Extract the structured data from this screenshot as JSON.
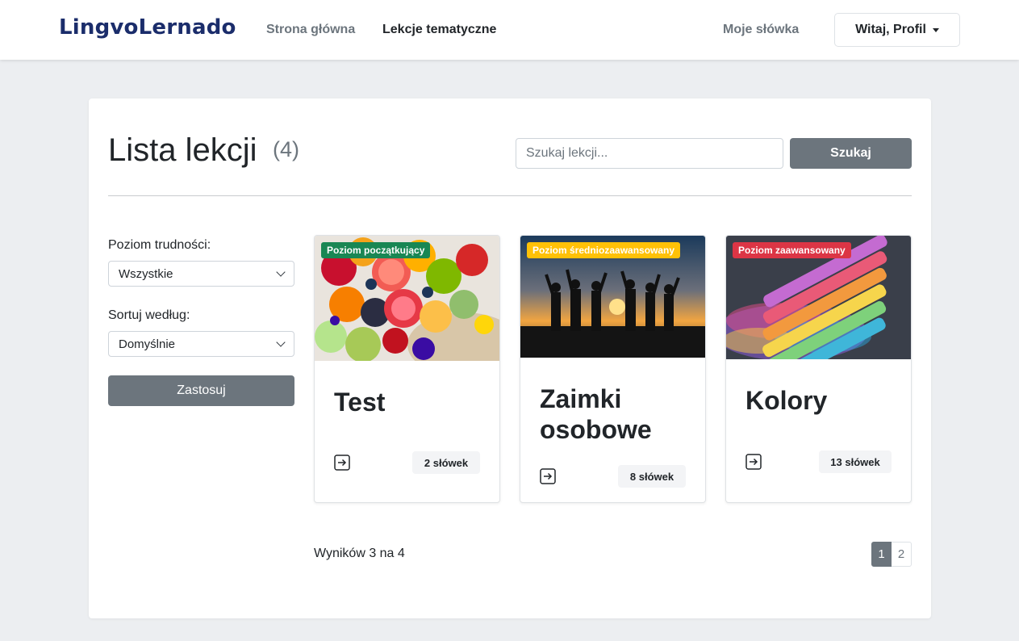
{
  "nav": {
    "brand": "LingvoLernado",
    "home": "Strona główna",
    "lessons": "Lekcje tematyczne",
    "my_words": "Moje słówka",
    "profile": "Witaj, Profil"
  },
  "header": {
    "title": "Lista lekcji",
    "count": "(4)",
    "search_placeholder": "Szukaj lekcji...",
    "search_button": "Szukaj"
  },
  "filters": {
    "level_label": "Poziom trudności:",
    "level_value": "Wszystkie",
    "sort_label": "Sortuj według:",
    "sort_value": "Domyślnie",
    "apply_button": "Zastosuj"
  },
  "lessons": [
    {
      "title_lines": [
        "Test"
      ],
      "level": "Poziom początkujący",
      "words": "2 słówek",
      "badge_color": "#198754",
      "image": "fruit"
    },
    {
      "title_lines": [
        "Zaimki",
        "osobowe"
      ],
      "level": "Poziom średniozaawansowany",
      "words": "8 słówek",
      "badge_color": "#ffc107",
      "image": "sunset-people"
    },
    {
      "title_lines": [
        "Kolory"
      ],
      "level": "Poziom zaawansowany",
      "words": "13 słówek",
      "badge_color": "#dc3545",
      "image": "chalk"
    }
  ],
  "footer": {
    "results": "Wyników 3 na 4",
    "pages": [
      "1",
      "2"
    ],
    "current_page": "1"
  },
  "icons": {
    "enter": "box-arrow-in-right-icon",
    "caret": "caret-down-icon",
    "select": "chevron-down-icon"
  }
}
